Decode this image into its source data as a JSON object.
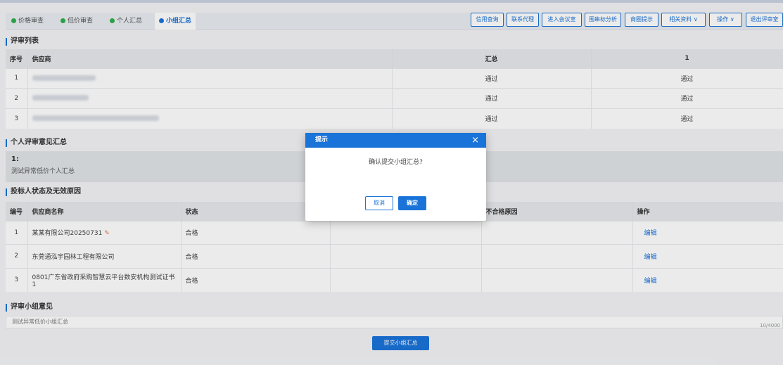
{
  "tabs": [
    {
      "label": "价格审查",
      "color": "#2fae4a"
    },
    {
      "label": "低价审查",
      "color": "#2fae4a"
    },
    {
      "label": "个人汇总",
      "color": "#2fae4a"
    },
    {
      "label": "小组汇总",
      "color": "#1a73d9"
    }
  ],
  "toolbar": [
    "信用查询",
    "联系代理",
    "进入会议室",
    "围串标分析",
    "商圈提示",
    "相关资料 ∨",
    "操作 ∨",
    "退出评审室"
  ],
  "review_list": {
    "title": "评审列表",
    "headers": [
      "序号",
      "供应商",
      "汇总",
      "1"
    ],
    "rows": [
      {
        "no": "1",
        "summary": "通过",
        "r1": "通过"
      },
      {
        "no": "2",
        "summary": "通过",
        "r1": "通过"
      },
      {
        "no": "3",
        "summary": "通过",
        "r1": "通过"
      }
    ]
  },
  "personal": {
    "title": "个人评审意见汇总",
    "key": "1:",
    "value": "测试异常低价个人汇总"
  },
  "bidder_status": {
    "title": "投标人状态及无效原因",
    "headers": [
      "编号",
      "供应商名称",
      "状态",
      "",
      "不合格原因",
      "操作"
    ],
    "rows": [
      {
        "no": "1",
        "name": "某某有限公司20250731",
        "status": "合格",
        "action": "编辑"
      },
      {
        "no": "2",
        "name": "东莞通泓宇园林工程有限公司",
        "status": "合格",
        "action": "编辑"
      },
      {
        "no": "3",
        "name": "0801广东省政府采购智慧云平台数安机构测试证书1",
        "status": "合格",
        "action": "编辑"
      }
    ]
  },
  "group_opinion": {
    "title": "评审小组意见",
    "text": "测试异常低价小组汇总",
    "counter": "10/4000"
  },
  "submit_label": "提交小组汇总",
  "modal": {
    "title": "提示",
    "close": "×",
    "message": "确认提交小组汇总?",
    "cancel": "取消",
    "ok": "确定"
  }
}
